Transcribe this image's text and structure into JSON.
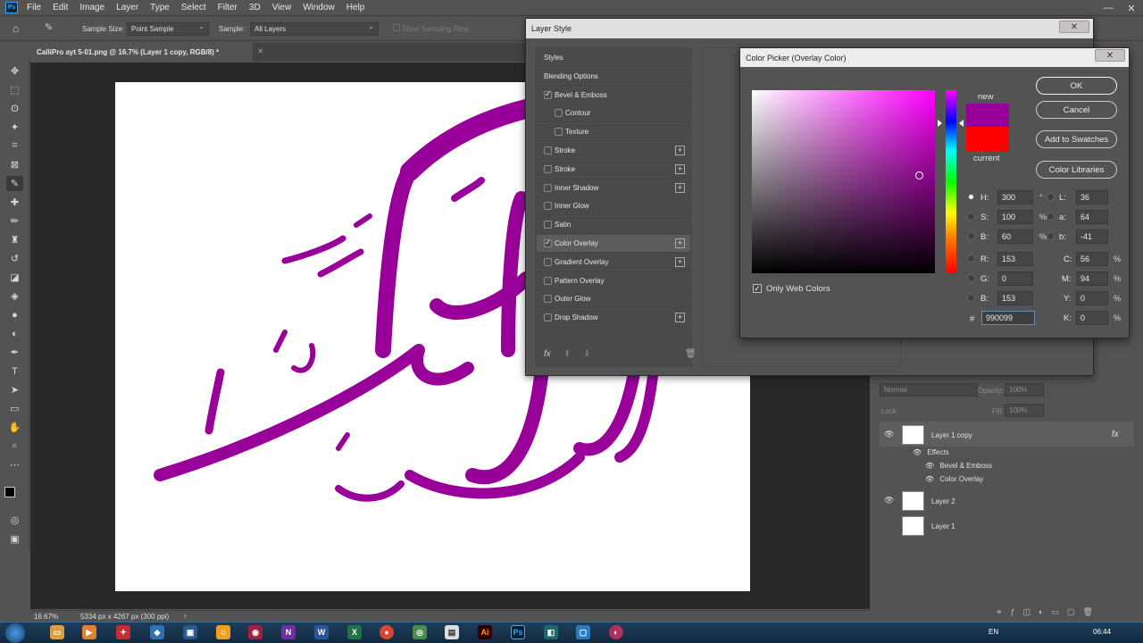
{
  "menubar": {
    "app_logo": "Ps",
    "items": [
      "File",
      "Edit",
      "Image",
      "Layer",
      "Type",
      "Select",
      "Filter",
      "3D",
      "View",
      "Window",
      "Help"
    ]
  },
  "options": {
    "sample_size_label": "Sample Size:",
    "sample_size_value": "Point Sample",
    "sample_label": "Sample:",
    "sample_value": "All Layers",
    "show_ring": "Show Sampling Ring"
  },
  "document": {
    "tab_title": "CalliPro ayt 5-01.png @ 16.7% (Layer 1 copy, RGB/8) *",
    "zoom": "16.67%",
    "doc_info": "5334 px x 4267 px (300 ppi)"
  },
  "layer_style": {
    "title": "Layer Style",
    "items": [
      {
        "label": "Styles",
        "type": "header"
      },
      {
        "label": "Blending Options",
        "type": "header"
      },
      {
        "label": "Bevel & Emboss",
        "checked": true
      },
      {
        "label": "Contour",
        "checked": false,
        "sub": true
      },
      {
        "label": "Texture",
        "checked": false,
        "sub": true
      },
      {
        "label": "Stroke",
        "checked": false,
        "plus": true
      },
      {
        "label": "Stroke",
        "checked": false,
        "plus": true
      },
      {
        "label": "Inner Shadow",
        "checked": false,
        "plus": true
      },
      {
        "label": "Inner Glow",
        "checked": false
      },
      {
        "label": "Satin",
        "checked": false
      },
      {
        "label": "Color Overlay",
        "checked": true,
        "plus": true,
        "selected": true
      },
      {
        "label": "Gradient Overlay",
        "checked": false,
        "plus": true
      },
      {
        "label": "Pattern Overlay",
        "checked": false
      },
      {
        "label": "Outer Glow",
        "checked": false
      },
      {
        "label": "Drop Shadow",
        "checked": false,
        "plus": true
      }
    ]
  },
  "color_picker": {
    "title": "Color Picker (Overlay Color)",
    "new_label": "new",
    "current_label": "current",
    "new_color": "#990099",
    "current_color": "#ff0000",
    "ok": "OK",
    "cancel": "Cancel",
    "add_swatches": "Add to Swatches",
    "color_libraries": "Color Libraries",
    "only_web_colors": "Only Web Colors",
    "H": "300",
    "S": "100",
    "B": "60",
    "R": "153",
    "G": "0",
    "Bl": "153",
    "L": "36",
    "a": "64",
    "b": "-41",
    "C": "56",
    "M": "94",
    "Y": "0",
    "K": "0",
    "hex": "990099",
    "deg": "°",
    "pct": "%"
  },
  "layers_panel": {
    "blend_mode": "Normal",
    "opacity_label": "Opacity:",
    "opacity": "100%",
    "lock_label": "Lock:",
    "fill_label": "Fill:",
    "fill": "100%",
    "layers": [
      {
        "name": "Layer 1 copy",
        "visible": true,
        "fx": "fx"
      },
      {
        "name": "Layer 2",
        "visible": true
      },
      {
        "name": "Layer 1",
        "visible": false
      }
    ],
    "effects_label": "Effects",
    "effects": [
      "Bevel & Emboss",
      "Color Overlay"
    ]
  },
  "taskbar": {
    "lang": "EN",
    "time": "06:44"
  },
  "colors": {
    "calligraphy": "#990099",
    "accent_new": "#990099",
    "accent_current": "#ff0000"
  }
}
